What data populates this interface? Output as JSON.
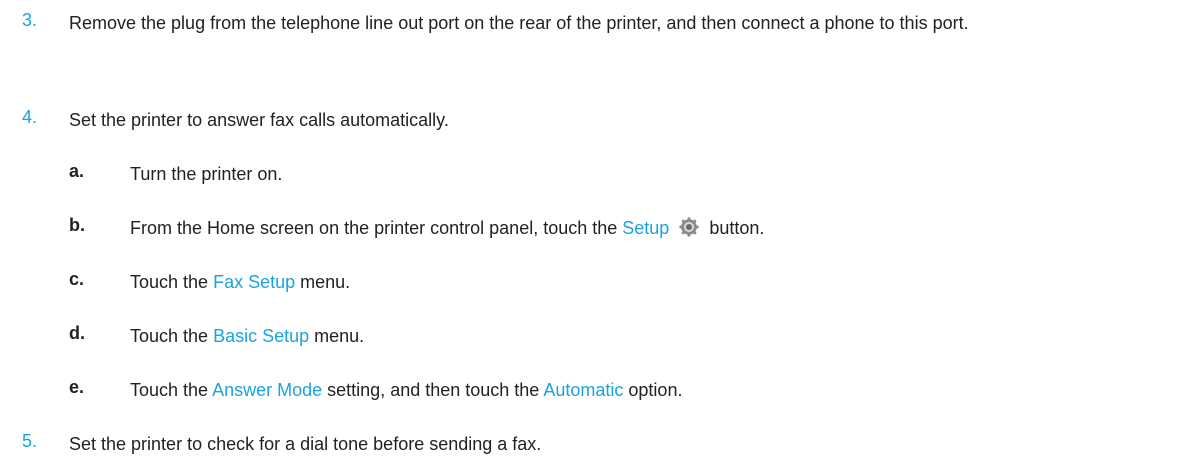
{
  "steps": [
    {
      "num": "3.",
      "text": "Remove the plug from the telephone line out port on the rear of the printer, and then connect a phone to this port."
    },
    {
      "num": "4.",
      "text": "Set the printer to answer fax calls automatically."
    },
    {
      "num": "5.",
      "text": "Set the printer to check for a dial tone before sending a fax."
    }
  ],
  "substeps": {
    "a": {
      "label": "a.",
      "text": "Turn the printer on."
    },
    "b": {
      "label": "b.",
      "pre": "From the Home screen on the printer control panel, touch the",
      "link": "Setup",
      "post": "button.",
      "icon": "setup-gear-icon"
    },
    "c": {
      "label": "c.",
      "pre": "Touch the",
      "link": "Fax Setup",
      "post": "menu."
    },
    "d": {
      "label": "d.",
      "pre": "Touch the",
      "link": "Basic Setup",
      "post": "menu."
    },
    "e": {
      "label": "e.",
      "pre": "Touch the",
      "link": "Answer Mode",
      "mid": "setting, and then touch the",
      "link2": "Automatic",
      "post": "option."
    }
  },
  "colors": {
    "accent": "#1aa3e0",
    "text": "#222222"
  }
}
